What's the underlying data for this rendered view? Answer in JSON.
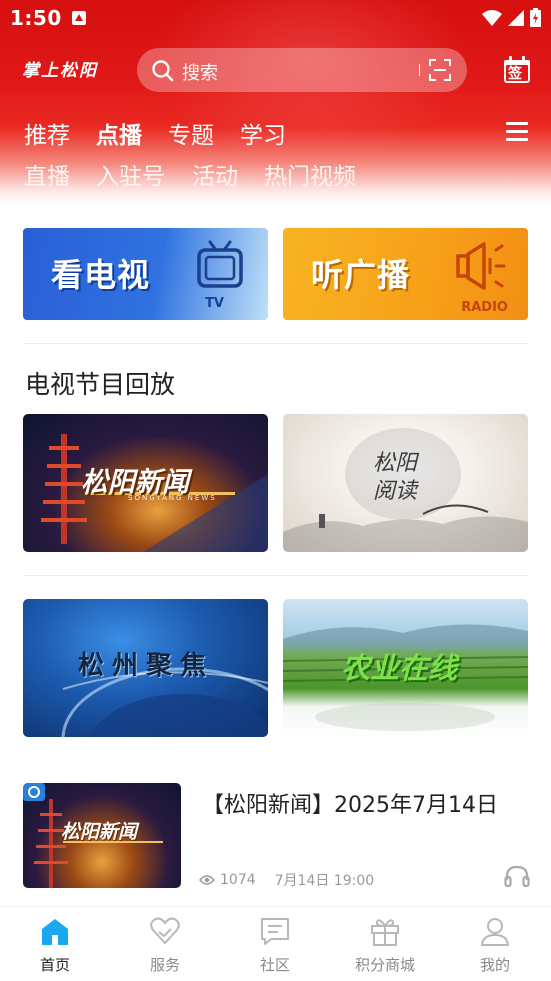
{
  "status_bar": {
    "time": "1:50"
  },
  "header": {
    "logo_text": "掌上松阳",
    "search_placeholder": "搜索",
    "sign_icon_text": "签",
    "nav_primary": [
      {
        "label": "推荐",
        "active": false
      },
      {
        "label": "点播",
        "active": true
      },
      {
        "label": "专题",
        "active": false
      },
      {
        "label": "学习",
        "active": false
      }
    ],
    "nav_secondary": [
      {
        "label": "直播"
      },
      {
        "label": "入驻号"
      },
      {
        "label": "活动"
      },
      {
        "label": "热门视频"
      }
    ]
  },
  "quick_entries": {
    "tv": {
      "title": "看电视",
      "sub": "TV"
    },
    "radio": {
      "title": "听广播",
      "sub": "RADIO"
    }
  },
  "section": {
    "title": "电视节目回放"
  },
  "programs": [
    {
      "name": "松阳新闻",
      "sub": "SONGYANG NEWS"
    },
    {
      "name": "松阳阅读"
    },
    {
      "name": "松州聚焦"
    },
    {
      "name": "农业在线"
    }
  ],
  "news_item": {
    "title": "【松阳新闻】2025年7月14日",
    "views": "1074",
    "date": "7月14日 19:00"
  },
  "tab_bar": [
    {
      "label": "首页",
      "icon": "home-icon",
      "active": true
    },
    {
      "label": "服务",
      "icon": "heart-icon",
      "active": false
    },
    {
      "label": "社区",
      "icon": "chat-icon",
      "active": false
    },
    {
      "label": "积分商城",
      "icon": "gift-icon",
      "active": false
    },
    {
      "label": "我的",
      "icon": "user-icon",
      "active": false
    }
  ],
  "colors": {
    "brand_red": "#e01818",
    "tab_active": "#1aa9f0",
    "tv_blue": "#2f72e0",
    "radio_orange": "#f7a018"
  }
}
